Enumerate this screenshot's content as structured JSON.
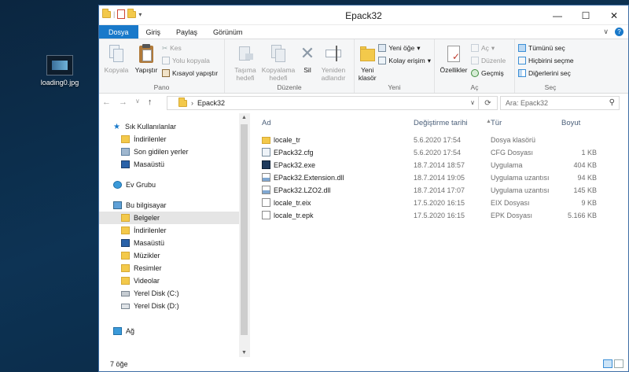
{
  "desktop": {
    "icon_label": "loading0.jpg"
  },
  "window": {
    "title": "Epack32"
  },
  "tabs": [
    "Dosya",
    "Giriş",
    "Paylaş",
    "Görünüm"
  ],
  "ribbon": {
    "pano": {
      "label": "Pano",
      "kopyala": "Kopyala",
      "yapistir": "Yapıştır",
      "kes": "Kes",
      "yolu_kopyala": "Yolu kopyala",
      "kisayol": "Kısayol yapıştır"
    },
    "duzenle": {
      "label": "Düzenle",
      "tasima_1": "Taşıma",
      "tasima_2": "hedefi",
      "kopyalama_1": "Kopyalama",
      "kopyalama_2": "hedefi",
      "sil": "Sil",
      "yeniden_1": "Yeniden",
      "yeniden_2": "adlandır"
    },
    "yeni": {
      "label": "Yeni",
      "klasor_1": "Yeni",
      "klasor_2": "klasör",
      "yeni_oge": "Yeni öğe",
      "kolay_erisim": "Kolay erişim"
    },
    "ac": {
      "label": "Aç",
      "ozellikler": "Özellikler",
      "ac": "Aç",
      "duzenle": "Düzenle",
      "gecmis": "Geçmiş"
    },
    "sec": {
      "label": "Seç",
      "tumunu": "Tümünü seç",
      "hicbirini": "Hiçbirini seçme",
      "digerlerini": "Diğerlerini seç"
    }
  },
  "address": {
    "path": "Epack32",
    "search_placeholder": "Ara: Epack32"
  },
  "nav": {
    "hizli": "Sık Kullanılanlar",
    "hizli_items": [
      "İndirilenler",
      "Son gidilen yerler",
      "Masaüstü"
    ],
    "ev_grubu": "Ev Grubu",
    "bu_pc": "Bu bilgisayar",
    "pc_items": [
      "Belgeler",
      "İndirilenler",
      "Masaüstü",
      "Müzikler",
      "Resimler",
      "Videolar",
      "Yerel Disk (C:)",
      "Yerel Disk (D:)"
    ],
    "ag": "Ağ"
  },
  "columns": {
    "name": "Ad",
    "date": "Değiştirme tarihi",
    "type": "Tür",
    "size": "Boyut"
  },
  "files": [
    {
      "name": "locale_tr",
      "date": "5.6.2020 17:54",
      "type": "Dosya klasörü",
      "size": "",
      "icon": "folder-icon"
    },
    {
      "name": "EPack32.cfg",
      "date": "5.6.2020 17:54",
      "type": "CFG Dosyası",
      "size": "1 KB",
      "icon": "settings-file-icon"
    },
    {
      "name": "EPack32.exe",
      "date": "18.7.2014 18:57",
      "type": "Uygulama",
      "size": "404 KB",
      "icon": "app-icon"
    },
    {
      "name": "EPack32.Extension.dll",
      "date": "18.7.2014 19:05",
      "type": "Uygulama uzantısı",
      "size": "94 KB",
      "icon": "dll-file-icon"
    },
    {
      "name": "EPack32.LZO2.dll",
      "date": "18.7.2014 17:07",
      "type": "Uygulama uzantısı",
      "size": "145 KB",
      "icon": "dll-file-icon"
    },
    {
      "name": "locale_tr.eix",
      "date": "17.5.2020 16:15",
      "type": "EIX Dosyası",
      "size": "9 KB",
      "icon": "file-icon"
    },
    {
      "name": "locale_tr.epk",
      "date": "17.5.2020 16:15",
      "type": "EPK Dosyası",
      "size": "5.166 KB",
      "icon": "file-icon"
    }
  ],
  "status": {
    "count": "7 öğe"
  },
  "colors": {
    "accent": "#1979ca",
    "folder": "#f3c94b",
    "selection": "#e5e5e5"
  }
}
